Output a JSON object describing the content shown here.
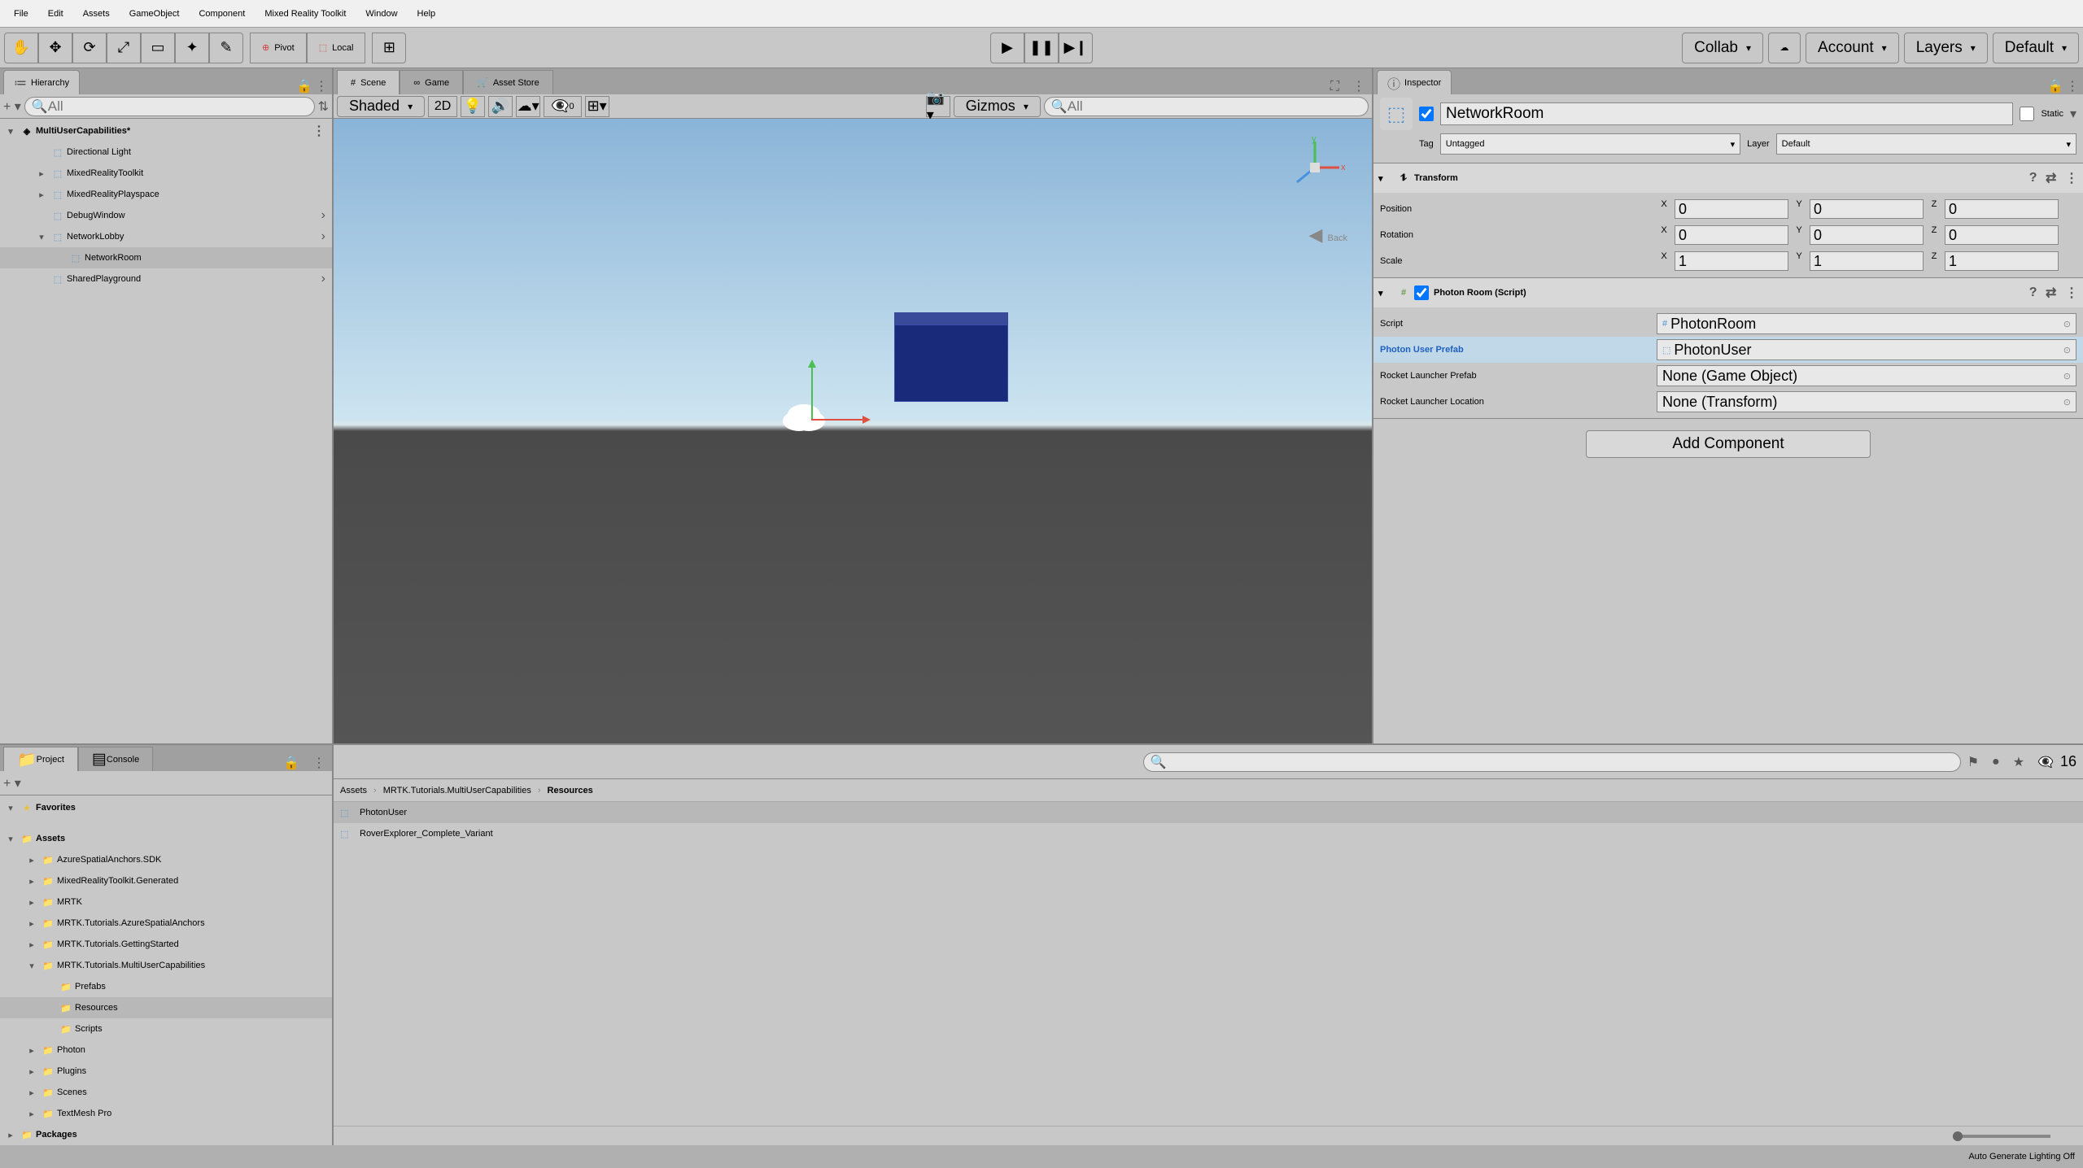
{
  "menubar": [
    "File",
    "Edit",
    "Assets",
    "GameObject",
    "Component",
    "Mixed Reality Toolkit",
    "Window",
    "Help"
  ],
  "toolbar": {
    "pivot": "Pivot",
    "local": "Local",
    "collab": "Collab",
    "account": "Account",
    "layers": "Layers",
    "layout": "Default"
  },
  "hierarchy": {
    "tab": "Hierarchy",
    "search_placeholder": "All",
    "scene_name": "MultiUserCapabilities*",
    "items": [
      {
        "indent": 1,
        "arrow": "",
        "name": "Directional Light",
        "icon": "cube"
      },
      {
        "indent": 1,
        "arrow": "▸",
        "name": "MixedRealityToolkit",
        "icon": "cube"
      },
      {
        "indent": 1,
        "arrow": "▸",
        "name": "MixedRealityPlayspace",
        "icon": "cube"
      },
      {
        "indent": 1,
        "arrow": "",
        "name": "DebugWindow",
        "icon": "cube",
        "expand": true
      },
      {
        "indent": 1,
        "arrow": "▾",
        "name": "NetworkLobby",
        "icon": "cube",
        "expand": true
      },
      {
        "indent": 2,
        "arrow": "",
        "name": "NetworkRoom",
        "icon": "cube",
        "selected": true
      },
      {
        "indent": 1,
        "arrow": "",
        "name": "SharedPlayground",
        "icon": "cube",
        "expand": true
      }
    ]
  },
  "center": {
    "tabs": [
      {
        "label": "Scene",
        "active": true,
        "icon": "#"
      },
      {
        "label": "Game",
        "active": false,
        "icon": "∞"
      },
      {
        "label": "Asset Store",
        "active": false,
        "icon": "🛒"
      }
    ],
    "shade_mode": "Shaded",
    "mode_2d": "2D",
    "hidden_count": "0",
    "gizmos": "Gizmos",
    "search_placeholder": "All",
    "back": "Back"
  },
  "inspector": {
    "tab": "Inspector",
    "static": "Static",
    "name": "NetworkRoom",
    "tag_label": "Tag",
    "tag_value": "Untagged",
    "layer_label": "Layer",
    "layer_value": "Default",
    "transform": {
      "title": "Transform",
      "rows": [
        {
          "label": "Position",
          "x": "0",
          "y": "0",
          "z": "0"
        },
        {
          "label": "Rotation",
          "x": "0",
          "y": "0",
          "z": "0"
        },
        {
          "label": "Scale",
          "x": "1",
          "y": "1",
          "z": "1"
        }
      ]
    },
    "photon_room": {
      "title": "Photon Room (Script)",
      "props": [
        {
          "label": "Script",
          "value": "PhotonRoom",
          "icon": "#"
        },
        {
          "label": "Photon User Prefab",
          "value": "PhotonUser",
          "icon": "⬚",
          "highlighted": true
        },
        {
          "label": "Rocket Launcher Prefab",
          "value": "None (Game Object)"
        },
        {
          "label": "Rocket Launcher Location",
          "value": "None (Transform)"
        }
      ]
    },
    "add_component": "Add Component"
  },
  "project": {
    "tab": "Project",
    "console_tab": "Console",
    "favorites": "Favorites",
    "assets_root": "Assets",
    "tree": [
      {
        "indent": 1,
        "arrow": "▸",
        "name": "AzureSpatialAnchors.SDK"
      },
      {
        "indent": 1,
        "arrow": "▸",
        "name": "MixedRealityToolkit.Generated"
      },
      {
        "indent": 1,
        "arrow": "▸",
        "name": "MRTK"
      },
      {
        "indent": 1,
        "arrow": "▸",
        "name": "MRTK.Tutorials.AzureSpatialAnchors"
      },
      {
        "indent": 1,
        "arrow": "▸",
        "name": "MRTK.Tutorials.GettingStarted"
      },
      {
        "indent": 1,
        "arrow": "▾",
        "name": "MRTK.Tutorials.MultiUserCapabilities"
      },
      {
        "indent": 2,
        "arrow": "",
        "name": "Prefabs"
      },
      {
        "indent": 2,
        "arrow": "",
        "name": "Resources",
        "selected": true
      },
      {
        "indent": 2,
        "arrow": "",
        "name": "Scripts"
      },
      {
        "indent": 1,
        "arrow": "▸",
        "name": "Photon"
      },
      {
        "indent": 1,
        "arrow": "▸",
        "name": "Plugins"
      },
      {
        "indent": 1,
        "arrow": "▸",
        "name": "Scenes"
      },
      {
        "indent": 1,
        "arrow": "▸",
        "name": "TextMesh Pro"
      }
    ],
    "packages": "Packages"
  },
  "assets_view": {
    "breadcrumb": [
      "Assets",
      "MRTK.Tutorials.MultiUserCapabilities",
      "Resources"
    ],
    "items": [
      {
        "name": "PhotonUser",
        "selected": true
      },
      {
        "name": "RoverExplorer_Complete_Variant"
      }
    ],
    "slider_count": "16"
  },
  "statusbar": {
    "lighting": "Auto Generate Lighting Off"
  }
}
